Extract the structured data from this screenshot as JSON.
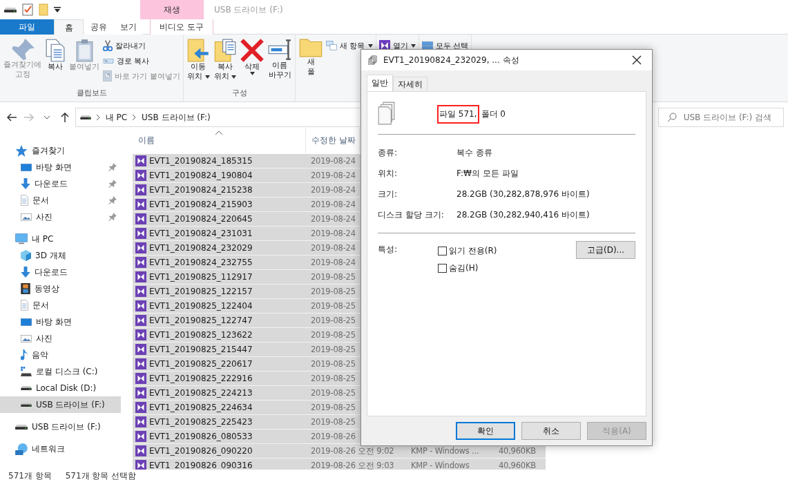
{
  "title_bar": {
    "contextual_tab": "재생",
    "title": "USB 드라이브 (F:)"
  },
  "ribbon_tabs": [
    {
      "label": "파일",
      "kind": "file",
      "selected": false
    },
    {
      "label": "홈",
      "kind": "tab",
      "selected": true
    },
    {
      "label": "공유",
      "kind": "tab",
      "selected": false
    },
    {
      "label": "보기",
      "kind": "tab",
      "selected": false
    },
    {
      "label": "비디오 도구",
      "kind": "contextual",
      "selected": false
    }
  ],
  "ribbon_groups": [
    {
      "label": "클립보드",
      "large": [
        {
          "kind": "pin",
          "lines": [
            "즐겨찾기에",
            "고정"
          ],
          "disabled": true,
          "dropdown": false
        },
        {
          "kind": "copy",
          "lines": [
            "복사"
          ],
          "disabled": false,
          "dropdown": false
        },
        {
          "kind": "paste",
          "lines": [
            "붙여넣기"
          ],
          "disabled": true,
          "dropdown": false
        }
      ],
      "small": [
        {
          "kind": "cut",
          "label": "잘라내기",
          "disabled": false,
          "dropdown": false
        },
        {
          "kind": "copypath",
          "label": "경로 복사",
          "disabled": false,
          "dropdown": false
        },
        {
          "kind": "pasteshortcut",
          "label": "바로 가기 붙여넣기",
          "disabled": true,
          "dropdown": false
        }
      ]
    },
    {
      "label": "구성",
      "large": [
        {
          "kind": "move",
          "lines": [
            "이동",
            "위치"
          ],
          "disabled": false,
          "dropdown": true
        },
        {
          "kind": "copyto",
          "lines": [
            "복사",
            "위치"
          ],
          "disabled": false,
          "dropdown": true
        },
        {
          "kind": "delete",
          "lines": [
            "삭제"
          ],
          "disabled": false,
          "dropdown": true
        },
        {
          "kind": "rename",
          "lines": [
            "이름",
            "바꾸기"
          ],
          "disabled": false,
          "dropdown": false
        }
      ]
    },
    {
      "large": [
        {
          "kind": "newfolder",
          "lines": [
            "새",
            "폴"
          ],
          "disabled": false,
          "dropdown": false
        }
      ],
      "small": [
        {
          "kind": "newitem",
          "label": "새 항목",
          "disabled": false,
          "dropdown": true
        }
      ]
    },
    {
      "small": [
        {
          "kind": "open",
          "label": "열기",
          "disabled": false,
          "dropdown": true
        }
      ]
    },
    {
      "small": [
        {
          "kind": "selectall",
          "label": "모두 선택",
          "disabled": false,
          "dropdown": false
        }
      ]
    }
  ],
  "address": {
    "segments": [
      "내 PC",
      "USB 드라이브 (F:)"
    ]
  },
  "search": {
    "placeholder": "USB 드라이브 (F:) 검색"
  },
  "navigation": [
    {
      "label": "즐겨찾기",
      "kind": "quickaccess",
      "selected": false,
      "children": [
        {
          "label": "바탕 화면",
          "kind": "desktop",
          "pinned": true,
          "selected": false
        },
        {
          "label": "다운로드",
          "kind": "downloads",
          "pinned": true,
          "selected": false
        },
        {
          "label": "문서",
          "kind": "documents",
          "pinned": true,
          "selected": false
        },
        {
          "label": "사진",
          "kind": "pictures",
          "pinned": true,
          "selected": false
        }
      ]
    },
    {
      "label": "내 PC",
      "kind": "pc",
      "selected": false,
      "children": [
        {
          "label": "3D 개체",
          "kind": "objects3d",
          "pinned": false,
          "selected": false
        },
        {
          "label": "다운로드",
          "kind": "downloads",
          "pinned": false,
          "selected": false
        },
        {
          "label": "동영상",
          "kind": "videos",
          "pinned": false,
          "selected": false
        },
        {
          "label": "문서",
          "kind": "documents",
          "pinned": false,
          "selected": false
        },
        {
          "label": "바탕 화면",
          "kind": "desktop",
          "pinned": false,
          "selected": false
        },
        {
          "label": "사진",
          "kind": "pictures",
          "pinned": false,
          "selected": false
        },
        {
          "label": "음악",
          "kind": "music",
          "pinned": false,
          "selected": false
        },
        {
          "label": "로컬 디스크 (C:)",
          "kind": "systemdisk",
          "pinned": false,
          "selected": false
        },
        {
          "label": "Local Disk (D:)",
          "kind": "disk",
          "pinned": false,
          "selected": false
        },
        {
          "label": "USB 드라이브 (F:)",
          "kind": "disk",
          "pinned": false,
          "selected": true
        }
      ]
    },
    {
      "label": "USB 드라이브 (F:)",
      "kind": "disk",
      "selected": false
    },
    {
      "label": "네트워크",
      "kind": "network",
      "selected": false
    }
  ],
  "columns": [
    {
      "label": "이름",
      "sorted": true
    },
    {
      "label": "수정한 날짜",
      "sorted": false
    }
  ],
  "files": [
    {
      "name": "EVT1_20190824_185315",
      "date": "2019-08-24",
      "selected": true
    },
    {
      "name": "EVT1_20190824_190804",
      "date": "2019-08-24",
      "selected": true
    },
    {
      "name": "EVT1_20190824_215238",
      "date": "2019-08-24",
      "selected": true
    },
    {
      "name": "EVT1_20190824_215903",
      "date": "2019-08-24",
      "selected": true
    },
    {
      "name": "EVT1_20190824_220645",
      "date": "2019-08-24",
      "selected": true
    },
    {
      "name": "EVT1_20190824_231031",
      "date": "2019-08-24",
      "selected": true
    },
    {
      "name": "EVT1_20190824_232029",
      "date": "2019-08-24",
      "selected": true
    },
    {
      "name": "EVT1_20190824_232755",
      "date": "2019-08-24",
      "selected": true
    },
    {
      "name": "EVT1_20190825_112917",
      "date": "2019-08-25",
      "selected": true
    },
    {
      "name": "EVT1_20190825_122157",
      "date": "2019-08-25",
      "selected": true
    },
    {
      "name": "EVT1_20190825_122404",
      "date": "2019-08-25",
      "selected": true
    },
    {
      "name": "EVT1_20190825_122747",
      "date": "2019-08-25",
      "selected": true
    },
    {
      "name": "EVT1_20190825_123622",
      "date": "2019-08-25",
      "selected": true
    },
    {
      "name": "EVT1_20190825_215447",
      "date": "2019-08-25",
      "selected": true
    },
    {
      "name": "EVT1_20190825_220617",
      "date": "2019-08-25",
      "selected": true
    },
    {
      "name": "EVT1_20190825_222916",
      "date": "2019-08-25",
      "selected": true
    },
    {
      "name": "EVT1_20190825_224213",
      "date": "2019-08-25",
      "selected": true
    },
    {
      "name": "EVT1_20190825_224634",
      "date": "2019-08-25",
      "selected": true
    },
    {
      "name": "EVT1_20190825_225423",
      "date": "2019-08-25",
      "selected": true
    },
    {
      "name": "EVT1_20190826_080533",
      "date": "2019-08-26",
      "selected": true
    },
    {
      "name": "EVT1_20190826_090220",
      "date": "2019-08-26 오전 9:02",
      "type": "KMP - Windows ...",
      "size": "40,960KB",
      "selected": true
    },
    {
      "name": "EVT1_20190826_090316",
      "date": "2019-08-26 오전 9:03",
      "type": "KMP - Windows",
      "size": "40,960KB",
      "selected": true
    }
  ],
  "status_bar": [
    "571개 항목",
    "571개 항목 선택함"
  ],
  "dialog": {
    "title": "EVT1_20190824_232029, ... 속성",
    "tabs": [
      {
        "label": "일반",
        "selected": true
      },
      {
        "label": "자세히",
        "selected": false
      }
    ],
    "summary": {
      "highlighted": "파일 571,",
      "rest": "폴더 0"
    },
    "properties": [
      {
        "label": "종류:",
        "value": "복수 종류"
      },
      {
        "label": "위치:",
        "value": "F:₩의 모든 파일"
      },
      {
        "label": "크기:",
        "value": "28.2GB (30,282,878,976 바이트)"
      },
      {
        "label": "디스크 할당 크기:",
        "value": "28.2GB (30,282,940,416 바이트)"
      }
    ],
    "attributes_label": "특성:",
    "attributes": [
      {
        "label": "읽기 전용(R)",
        "checked": false
      },
      {
        "label": "숨김(H)",
        "checked": false
      }
    ],
    "advanced_button": "고급(D)...",
    "buttons": [
      {
        "label": "확인",
        "default": true,
        "disabled": false
      },
      {
        "label": "취소",
        "default": false,
        "disabled": false
      },
      {
        "label": "적용(A)",
        "default": false,
        "disabled": true
      }
    ]
  }
}
